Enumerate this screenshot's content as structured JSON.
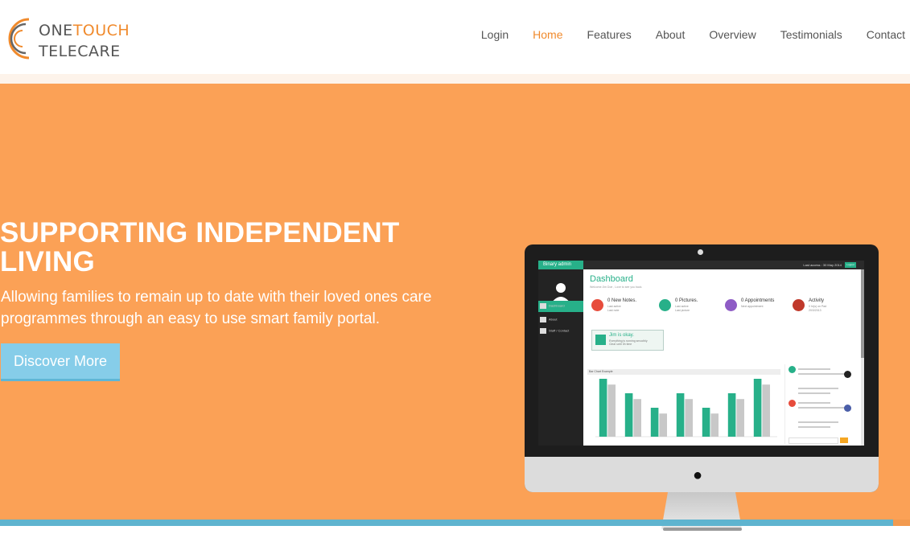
{
  "brand": {
    "line1_a": "ONE",
    "line1_b": "TOUCH",
    "line2": "TELECARE",
    "color_accent": "#f08a2c"
  },
  "nav": {
    "items": [
      {
        "label": "Login",
        "active": false
      },
      {
        "label": "Home",
        "active": true
      },
      {
        "label": "Features",
        "active": false
      },
      {
        "label": "About",
        "active": false
      },
      {
        "label": "Overview",
        "active": false
      },
      {
        "label": "Testimonials",
        "active": false
      },
      {
        "label": "Contact",
        "active": false
      }
    ]
  },
  "hero": {
    "title": "SUPPORTING INDEPENDENT LIVING",
    "subtitle": "Allowing families to remain up to date with their loved ones care programmes through an easy to use smart family portal.",
    "cta_label": "Discover More",
    "bg_color": "#fba156",
    "cta_color": "#86cde9"
  },
  "dashboard_screen": {
    "brand": "Binary admin",
    "last_session": "Last access : 30 May 2014",
    "logout": "Logout",
    "sidebar": [
      "Dashboard",
      "About",
      "Staff / Contact"
    ],
    "title": "Dashboard",
    "welcome": "Welcome Jim Doe , Love to see you back.",
    "stats": [
      {
        "label": "0 New Notes.",
        "sub1": "Last active",
        "sub2": "Last note",
        "color": "#e74c3c",
        "icon": "envelope-icon"
      },
      {
        "label": "0 Pictures.",
        "sub1": "Last active",
        "sub2": "Last picture",
        "color": "#27b089",
        "icon": "camera-icon"
      },
      {
        "label": "0 Appointments",
        "sub1": "Next appointment",
        "sub2": "",
        "color": "#8e5cc5",
        "icon": "calendar-icon"
      },
      {
        "label": "Activity",
        "sub1": "0 hr(s) on Pad",
        "sub2": "20/3/2013",
        "color": "#c0392b",
        "icon": "user-icon"
      }
    ],
    "alert_title": "Jim is okay.",
    "alert_sub1": "Everything is running smoothly",
    "alert_sub2": "Clear until 3h time",
    "chart_title": "Bar Chart Example",
    "chart_data": {
      "type": "bar",
      "categories": [
        "",
        "",
        "",
        "",
        "",
        "",
        ""
      ],
      "series": [
        {
          "values": [
            100,
            75,
            50,
            75,
            50,
            75,
            100
          ],
          "color": "#27b089"
        },
        {
          "values": [
            90,
            65,
            40,
            65,
            40,
            65,
            90
          ],
          "color": "#c8c8c8"
        }
      ],
      "ylim": [
        0,
        100
      ]
    }
  }
}
